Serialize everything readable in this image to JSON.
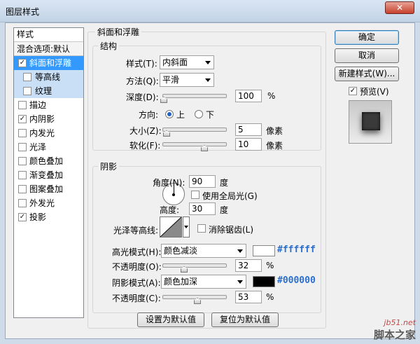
{
  "window": {
    "title": "图层样式",
    "close": "✕"
  },
  "style_list": {
    "header": "样式",
    "blend": "混合选项:默认",
    "items": [
      {
        "label": "斜面和浮雕",
        "checked": true
      },
      {
        "label": "等高线",
        "checked": false
      },
      {
        "label": "纹理",
        "checked": false
      },
      {
        "label": "描边",
        "checked": false
      },
      {
        "label": "内阴影",
        "checked": true
      },
      {
        "label": "内发光",
        "checked": false
      },
      {
        "label": "光泽",
        "checked": false
      },
      {
        "label": "颜色叠加",
        "checked": false
      },
      {
        "label": "渐变叠加",
        "checked": false
      },
      {
        "label": "图案叠加",
        "checked": false
      },
      {
        "label": "外发光",
        "checked": false
      },
      {
        "label": "投影",
        "checked": true
      }
    ]
  },
  "bevel": {
    "title": "斜面和浮雕",
    "structure": {
      "title": "结构",
      "style_label": "样式(T):",
      "style_value": "内斜面",
      "method_label": "方法(Q):",
      "method_value": "平滑",
      "depth_label": "深度(D):",
      "depth_value": "100",
      "depth_unit": "%",
      "direction_label": "方向:",
      "dir_up": "上",
      "dir_down": "下",
      "size_label": "大小(Z):",
      "size_value": "5",
      "size_unit": "像素",
      "soften_label": "软化(F):",
      "soften_value": "10",
      "soften_unit": "像素"
    },
    "shading": {
      "title": "阴影",
      "angle_label": "角度(N):",
      "angle_value": "90",
      "angle_unit": "度",
      "global_light": "使用全局光(G)",
      "altitude_label": "高度:",
      "altitude_value": "30",
      "altitude_unit": "度",
      "gloss_label": "光泽等高线:",
      "antialias": "消除锯齿(L)",
      "highlight_label": "高光模式(H):",
      "highlight_mode": "颜色减淡",
      "highlight_color": "#ffffff",
      "highlight_hex": "#ffffff",
      "hl_opacity_label": "不透明度(O):",
      "hl_opacity_value": "32",
      "hl_opacity_unit": "%",
      "shadow_label": "阴影模式(A):",
      "shadow_mode": "颜色加深",
      "shadow_color": "#000000",
      "shadow_hex": "#000000",
      "sh_opacity_label": "不透明度(C):",
      "sh_opacity_value": "53",
      "sh_opacity_unit": "%"
    },
    "make_default": "设置为默认值",
    "reset_default": "复位为默认值"
  },
  "buttons": {
    "ok": "确定",
    "cancel": "取消",
    "new_style": "新建样式(W)...",
    "preview": "预览(V)"
  },
  "watermark": {
    "url": "jb51.net",
    "name": "脚本之家"
  }
}
